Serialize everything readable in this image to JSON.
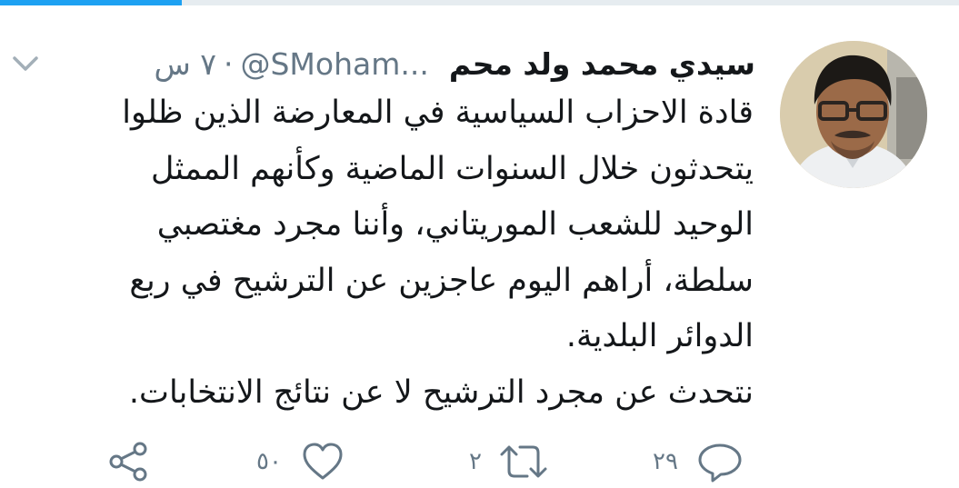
{
  "progress": {
    "fraction": 0.19,
    "color": "#1da1f2"
  },
  "tweet": {
    "author": {
      "display_name": "سيدي محمد ولد محم",
      "handle": "@SMoham...",
      "avatar_icon": "user-photo"
    },
    "separator": "·",
    "timestamp": "٧ س",
    "text_lines": [
      "قادة الاحزاب السياسية في المعارضة الذين ظلوا",
      "يتحدثون خلال السنوات الماضية وكأنهم الممثل",
      "الوحيد للشعب الموريتاني، وأننا مجرد مغتصبي",
      "سلطة، أراهم اليوم عاجزين عن الترشيح في ربع",
      "الدوائر البلدية.",
      "نتحدث عن مجرد الترشيح لا عن نتائج الانتخابات."
    ],
    "actions": {
      "reply": {
        "icon": "reply-icon",
        "count": "٢٩"
      },
      "retweet": {
        "icon": "retweet-icon",
        "count": "٢"
      },
      "like": {
        "icon": "heart-icon",
        "count": "٥٠"
      },
      "share": {
        "icon": "share-icon"
      }
    },
    "menu_icon": "chevron-down-icon"
  },
  "colors": {
    "text": "#14171a",
    "secondary": "#657786",
    "accent": "#1da1f2"
  }
}
